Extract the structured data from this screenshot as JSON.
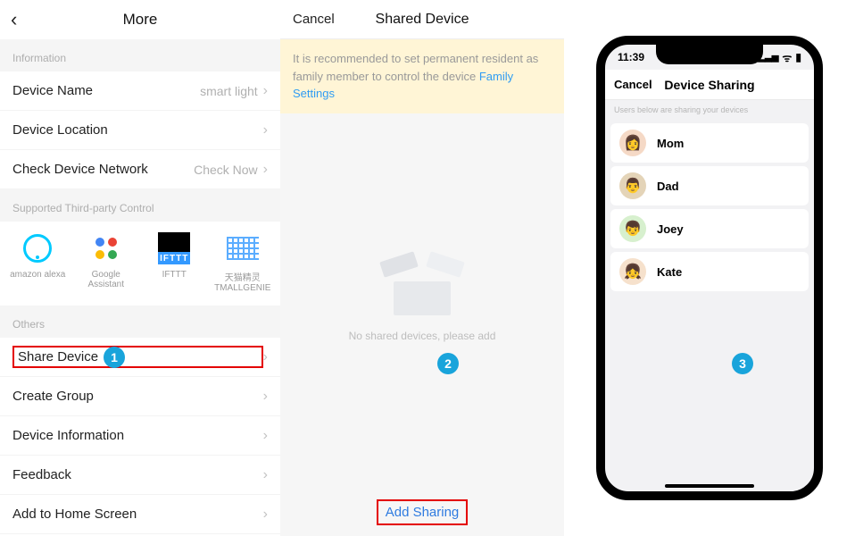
{
  "col1": {
    "title": "More",
    "info_label": "Information",
    "rows_info": [
      {
        "label": "Device Name",
        "value": "smart light",
        "chevron": true
      },
      {
        "label": "Device Location",
        "value": "",
        "chevron": true
      },
      {
        "label": "Check Device Network",
        "value": "Check Now",
        "chevron": true
      }
    ],
    "supported_label": "Supported Third-party Control",
    "integrations": [
      {
        "name": "alexa",
        "caption": "amazon alexa"
      },
      {
        "name": "google-assistant",
        "caption": "Google Assistant"
      },
      {
        "name": "ifttt",
        "caption": "IFTTT"
      },
      {
        "name": "tmall-genie",
        "caption": "天猫精灵\nTMALLGENIE"
      }
    ],
    "ifttt_text": "IFTTT",
    "others_label": "Others",
    "rows_others": [
      {
        "label": "Share Device",
        "highlight": true
      },
      {
        "label": "Create Group"
      },
      {
        "label": "Device Information"
      },
      {
        "label": "Feedback"
      },
      {
        "label": "Add to Home Screen"
      }
    ]
  },
  "col2": {
    "cancel": "Cancel",
    "title": "Shared Device",
    "banner_text": "It is recommended to set permanent resident as family member to control the device ",
    "banner_link": "Family Settings",
    "empty_text": "No shared devices, please add",
    "add_sharing": "Add Sharing"
  },
  "col3": {
    "time": "11:39",
    "cancel": "Cancel",
    "title": "Device Sharing",
    "subtitle": "Users below are sharing your devices",
    "members": [
      {
        "key": "mom",
        "name": "Mom"
      },
      {
        "key": "dad",
        "name": "Dad"
      },
      {
        "key": "joey",
        "name": "Joey"
      },
      {
        "key": "kate",
        "name": "Kate"
      }
    ]
  },
  "badges": {
    "b1": "1",
    "b2": "2",
    "b3": "3"
  }
}
